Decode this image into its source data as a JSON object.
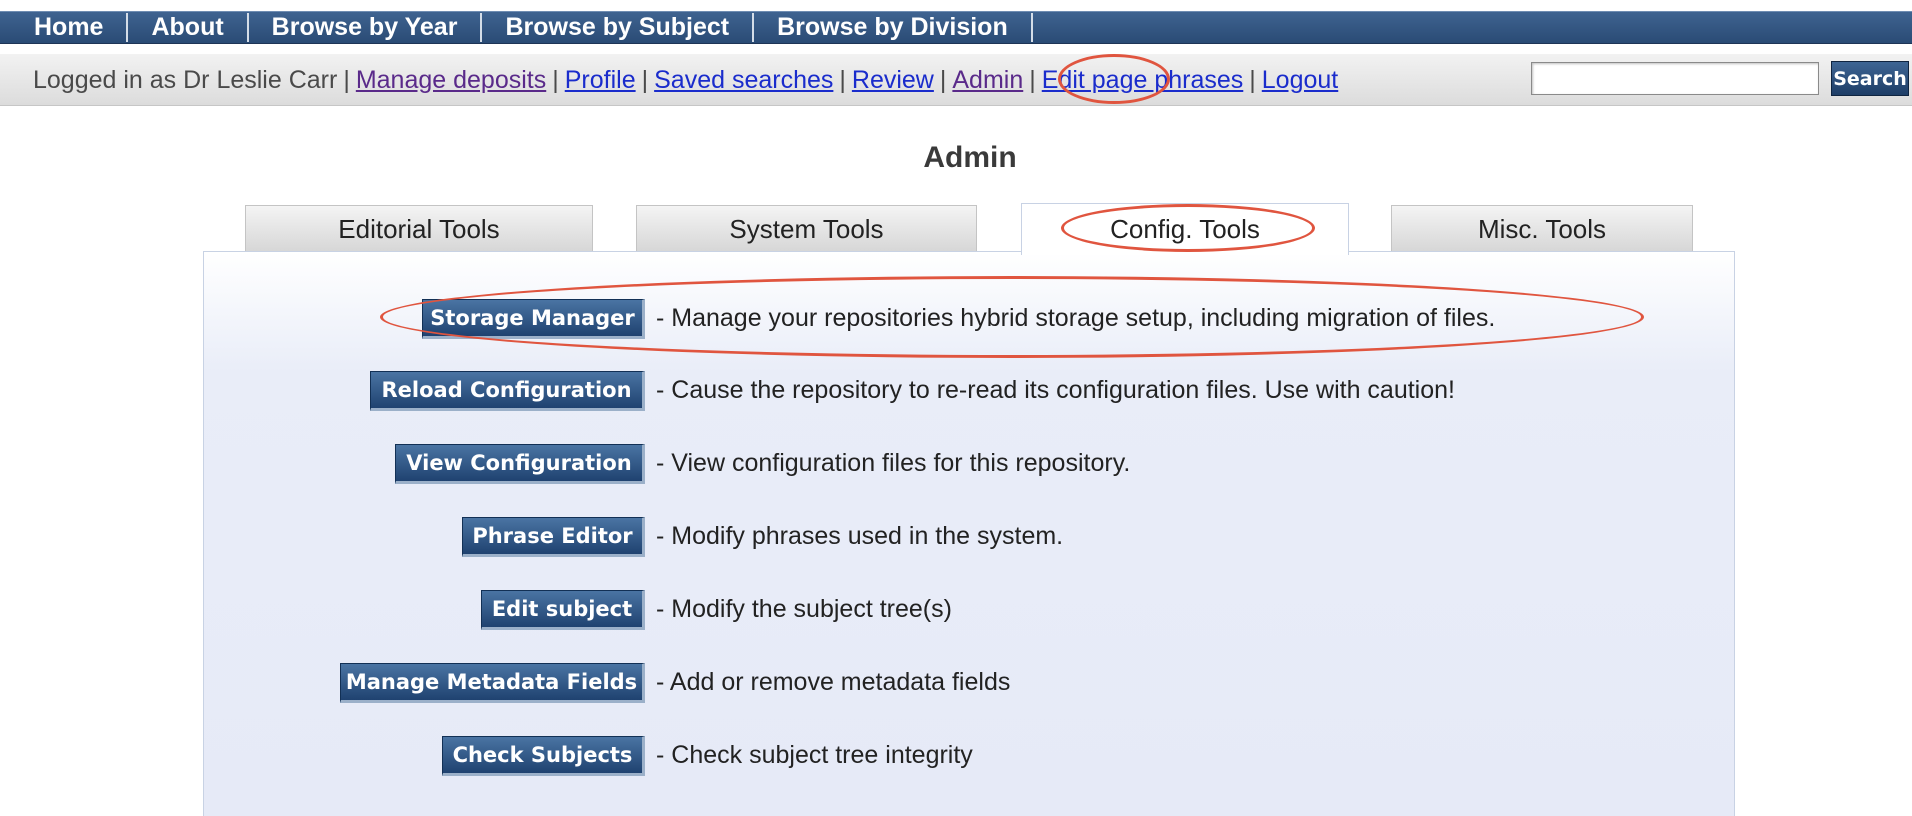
{
  "nav": {
    "items": [
      "Home",
      "About",
      "Browse by Year",
      "Browse by Subject",
      "Browse by Division"
    ]
  },
  "userbar": {
    "logged_in_text": "Logged in as Dr Leslie Carr",
    "separator": "|",
    "links": {
      "manage_deposits": "Manage deposits",
      "profile": "Profile",
      "saved_searches": "Saved searches",
      "review": "Review",
      "admin": "Admin",
      "edit_page_phrases": "Edit page phrases",
      "logout": "Logout"
    },
    "search": {
      "value": "",
      "button_label": "Search"
    }
  },
  "page": {
    "title": "Admin"
  },
  "tabs": [
    {
      "label": "Editorial Tools",
      "active": false
    },
    {
      "label": "System Tools",
      "active": false
    },
    {
      "label": "Config. Tools",
      "active": true
    },
    {
      "label": "Misc. Tools",
      "active": false
    }
  ],
  "tools": [
    {
      "button": "Storage Manager",
      "description": "- Manage your repositories hybrid storage setup, including migration of files."
    },
    {
      "button": "Reload Configuration",
      "description": "- Cause the repository to re-read its configuration files. Use with caution!"
    },
    {
      "button": "View Configuration",
      "description": "- View configuration files for this repository."
    },
    {
      "button": "Phrase Editor",
      "description": "- Modify phrases used in the system."
    },
    {
      "button": "Edit subject",
      "description": "- Modify the subject tree(s)"
    },
    {
      "button": "Manage Metadata Fields",
      "description": "- Add or remove metadata fields"
    },
    {
      "button": "Check Subjects",
      "description": "- Check subject tree integrity"
    }
  ],
  "colors": {
    "nav_bg": "#2f5280",
    "link": "#1a2ccc",
    "visited_link": "#5a2a8a",
    "button_bg": "#2a4d7c",
    "annotation": "#e0553f",
    "panel_bg": "#e8ecf8"
  }
}
